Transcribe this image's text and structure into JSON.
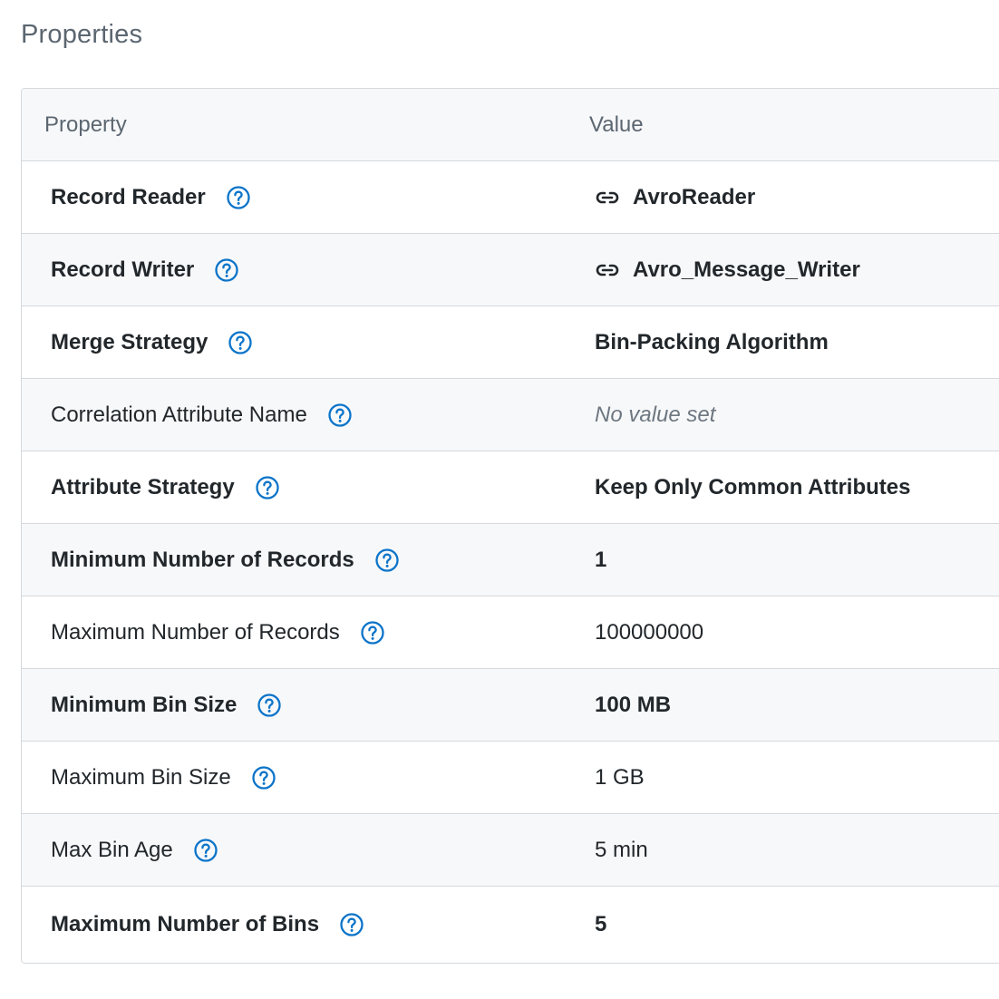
{
  "section_title": "Properties",
  "table": {
    "headers": {
      "property": "Property",
      "value": "Value"
    },
    "rows": [
      {
        "name": "Record Reader",
        "value": "AvroReader",
        "name_bold": true,
        "value_bold": true,
        "value_link": true
      },
      {
        "name": "Record Writer",
        "value": "Avro_Message_Writer",
        "name_bold": true,
        "value_bold": true,
        "value_link": true
      },
      {
        "name": "Merge Strategy",
        "value": "Bin-Packing Algorithm",
        "name_bold": true,
        "value_bold": true
      },
      {
        "name": "Correlation Attribute Name",
        "value": "No value set",
        "name_bold": false,
        "value_empty": true
      },
      {
        "name": "Attribute Strategy",
        "value": "Keep Only Common Attributes",
        "name_bold": true,
        "value_bold": true
      },
      {
        "name": "Minimum Number of Records",
        "value": "1",
        "name_bold": true,
        "value_bold": true
      },
      {
        "name": "Maximum Number of Records",
        "value": "100000000",
        "name_bold": false
      },
      {
        "name": "Minimum Bin Size",
        "value": "100 MB",
        "name_bold": true,
        "value_bold": true
      },
      {
        "name": "Maximum Bin Size",
        "value": "1 GB",
        "name_bold": false
      },
      {
        "name": "Max Bin Age",
        "value": "5 min",
        "name_bold": false
      },
      {
        "name": "Maximum Number of Bins",
        "value": "5",
        "name_bold": true,
        "value_bold": true
      }
    ]
  },
  "icons": {
    "help": "help-circle-icon",
    "link": "link-icon"
  },
  "colors": {
    "accent": "#0b74c9",
    "text": "#22272b",
    "muted": "#5b6670",
    "border": "#d5d9dd",
    "header_bg": "#f7f8fa"
  }
}
